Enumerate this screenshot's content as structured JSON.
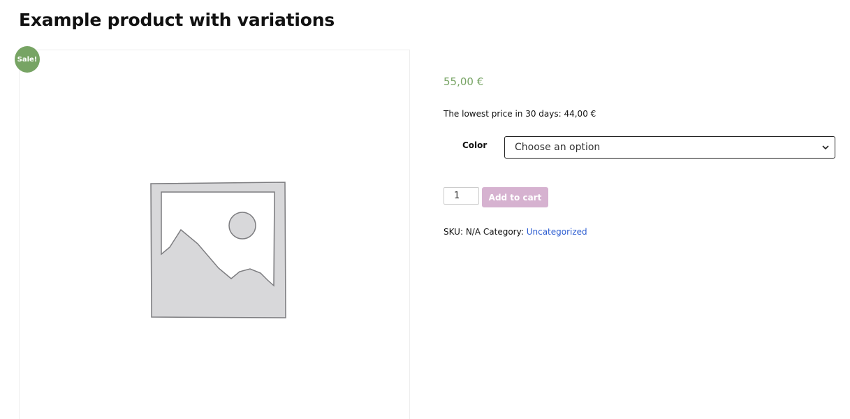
{
  "product": {
    "title": "Example product with variations",
    "sale_badge": "Sale!",
    "price": "55,00 €",
    "lowest_price_label": "The lowest price in 30 days: 44,00 €"
  },
  "variation": {
    "label": "Color",
    "selected": "Choose an option"
  },
  "cart": {
    "quantity": "1",
    "button_label": "Add to cart"
  },
  "meta": {
    "sku_label": "SKU:",
    "sku_value": "N/A",
    "category_label": "Category:",
    "category_link": "Uncategorized"
  },
  "colors": {
    "accent": "#77a464",
    "button_disabled": "#d6b2d0",
    "link": "#2b5cd1"
  }
}
